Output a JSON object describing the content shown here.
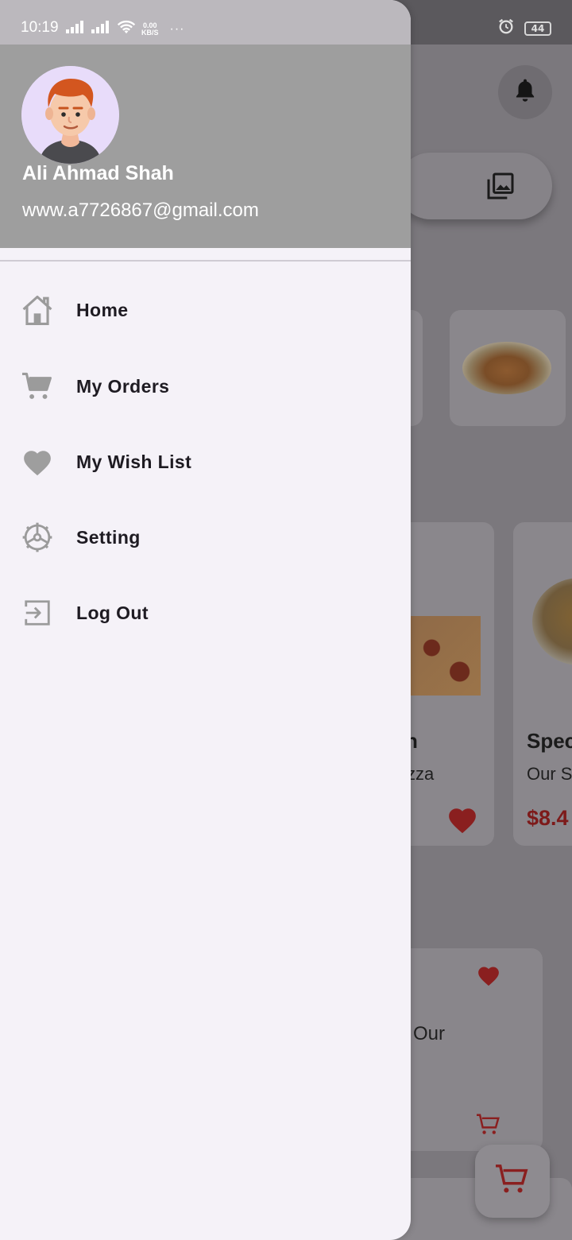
{
  "status_bar": {
    "time": "10:19",
    "net_speed": "0.00",
    "net_unit": "KB/S",
    "overflow": "···",
    "battery": "44"
  },
  "drawer": {
    "user": {
      "name": "Ali Ahmad Shah",
      "email": "www.a7726867@gmail.com"
    },
    "menu": [
      {
        "label": "Home",
        "icon": "home-icon"
      },
      {
        "label": "My Orders",
        "icon": "cart-icon"
      },
      {
        "label": "My Wish List",
        "icon": "heart-icon"
      },
      {
        "label": "Setting",
        "icon": "settings-icon"
      },
      {
        "label": "Log Out",
        "icon": "logout-icon"
      }
    ]
  },
  "background": {
    "card_pizza": {
      "title_fragment": "n",
      "subtitle_fragment": "zza"
    },
    "card_special": {
      "title_fragment": "Spec",
      "subtitle_fragment": "Our S",
      "price_fragment": "$8.4"
    },
    "wide_card": {
      "subtitle_fragment": "Our"
    }
  },
  "colors": {
    "drawer_bg": "#f5f2f8",
    "header_bg": "#9e9e9e",
    "accent_red": "#b22222",
    "icon_gray": "#9e9e9e"
  }
}
